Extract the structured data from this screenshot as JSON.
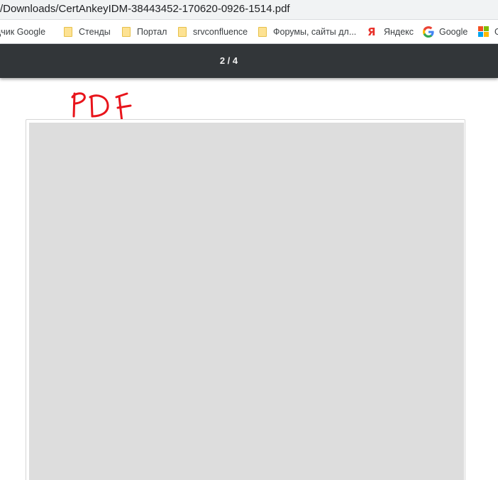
{
  "address_bar": {
    "url_text": "/Downloads/CertAnkeyIDM-38443452-170620-0926-1514.pdf"
  },
  "bookmarks": [
    {
      "label": "дчик Google",
      "icon": "none"
    },
    {
      "label": "Стенды",
      "icon": "folder-icon"
    },
    {
      "label": "Портал",
      "icon": "folder-icon"
    },
    {
      "label": "srvconfluence",
      "icon": "folder-icon"
    },
    {
      "label": "Форумы, сайты дл...",
      "icon": "folder-icon"
    },
    {
      "label": "Яндекс",
      "icon": "yandex-icon"
    },
    {
      "label": "Google",
      "icon": "google-icon"
    },
    {
      "label": "G",
      "icon": "microsoft-icon"
    }
  ],
  "icons": {
    "yandex_glyph": "Я"
  },
  "pdf_toolbar": {
    "page_indicator": "2 / 4"
  },
  "colors": {
    "toolbar_bg": "#323639",
    "annotation_red": "#e8141b",
    "page_placeholder": "#dddddd"
  },
  "annotation": {
    "handwritten_text": "PDF"
  }
}
